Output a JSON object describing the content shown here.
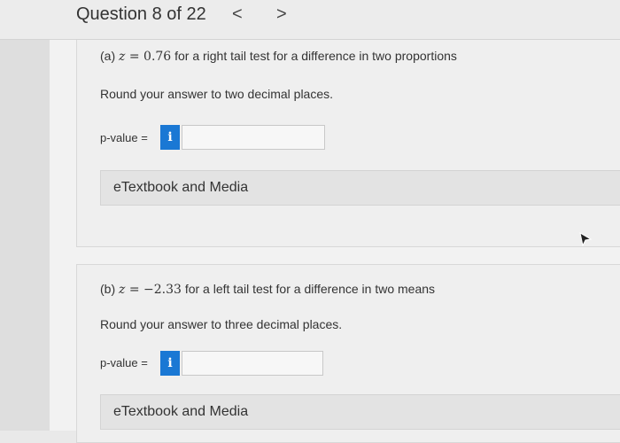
{
  "header": {
    "title": "Question 8 of 22",
    "prev_glyph": "<",
    "next_glyph": ">"
  },
  "part_a": {
    "prefix": "(a) ",
    "variable": "z",
    "equals": " = ",
    "value": "0.76",
    "description": " for a right tail test for a difference in two proportions",
    "round_instruction": "Round your answer to two decimal places.",
    "pvalue_label": "p-value =",
    "info_label": "i",
    "input_value": "",
    "etextbook_label": "eTextbook and Media"
  },
  "part_b": {
    "prefix": "(b) ",
    "variable": "z",
    "equals": " = ",
    "value": "−2.33",
    "description": " for a left tail test for a difference in two means",
    "round_instruction": "Round your answer to three decimal places.",
    "pvalue_label": "p-value =",
    "info_label": "i",
    "input_value": "",
    "etextbook_label": "eTextbook and Media"
  },
  "colors": {
    "info_button": "#1a78d4",
    "background": "#e9e9e9"
  },
  "icons": {
    "info": "info-icon",
    "prev": "chevron-left-icon",
    "next": "chevron-right-icon",
    "cursor": "mouse-pointer-icon"
  }
}
